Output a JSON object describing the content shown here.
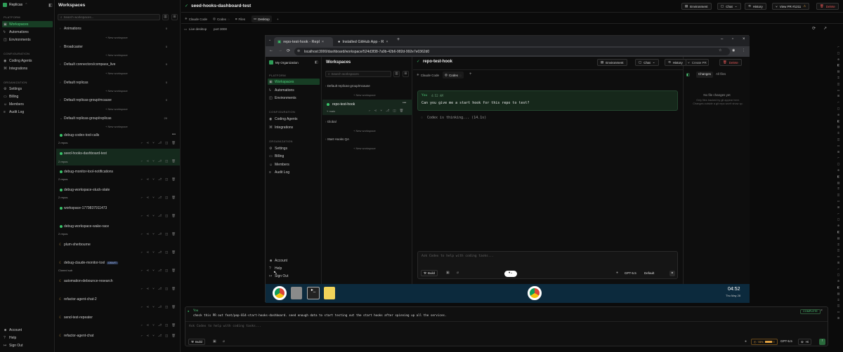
{
  "sidebar": {
    "org": "Replicas",
    "sections": {
      "platform": "PLATFORM",
      "configuration": "CONFIGURATION",
      "organization": "ORGANIZATION"
    },
    "platform_items": [
      "Workspaces",
      "Automations",
      "Environments"
    ],
    "config_items": [
      "Coding Agents",
      "Integrations"
    ],
    "org_items": [
      "Settings",
      "Billing",
      "Members",
      "Audit Log"
    ],
    "bottom_items": [
      "Account",
      "Help",
      "Sign Out"
    ]
  },
  "list": {
    "title": "Workspaces",
    "search_placeholder": "Search workspaces...",
    "groups": [
      {
        "name": "Animations",
        "count": "0"
      },
      {
        "name": "Broadcaster",
        "count": "0"
      },
      {
        "name": "Default connectors/compass_live",
        "count": "0"
      },
      {
        "name": "Default replicas",
        "count": "0"
      },
      {
        "name": "Default replicas-group/mcause",
        "count": "0"
      },
      {
        "name": "Default replicas-group/replicas",
        "count": "20"
      }
    ],
    "new_workspace": "+ New workspace",
    "workspaces": [
      {
        "name": "debug-codex-tool-calls",
        "repos": "2 repos"
      },
      {
        "name": "seed-hooks-dashboard-test",
        "repos": "2 repos"
      },
      {
        "name": "debug-monitor-tool-notifications",
        "repos": "2 repos"
      },
      {
        "name": "debug-workspace-stuck-state",
        "repos": "2 repos"
      },
      {
        "name": "workspace-1779837911473",
        "repos": ""
      },
      {
        "name": "debug-workspace-wake-race",
        "repos": "2 repos"
      },
      {
        "name": "plum-sherbourne",
        "repos": ""
      },
      {
        "name": "debug-claude-monitor-tool",
        "repos": "Cloned sub",
        "badge": "DRAFT"
      },
      {
        "name": "automation-debounce-research",
        "repos": ""
      },
      {
        "name": "refactor-agent-chat-2",
        "repos": ""
      },
      {
        "name": "send-test-repeater",
        "repos": ""
      },
      {
        "name": "refactor-agent-chat",
        "repos": ""
      }
    ]
  },
  "header": {
    "title": "seed-hooks-dashboard-test",
    "environment": "Environment",
    "chat": "Chat",
    "history": "History",
    "view_pr": "View PR #1211",
    "delete": "Delete"
  },
  "tabs": [
    "Claude Code",
    "Codex",
    "Files",
    "Desktop"
  ],
  "desktop_bar": {
    "live": "Live desktop",
    "port": "port 3000"
  },
  "vm": {
    "tab1": "repo-test-hook - Repl",
    "tab2": "Installed GitHub App - R",
    "url": "localhost:3000/dashboard/workspace/524d3f38-7a9b-42b6-982d-992e7e0362d0",
    "app": {
      "org": "My Organization",
      "sections": {
        "platform": "PLATFORM",
        "configuration": "CONFIGURATION",
        "organization": "ORGANIZATION"
      },
      "platform_items": [
        "Workspaces",
        "Automations",
        "Environments"
      ],
      "config_items": [
        "Coding Agents",
        "Integrations"
      ],
      "org_items": [
        "Settings",
        "Billing",
        "Members",
        "Audit Log"
      ],
      "bottom_items": [
        "Account",
        "Help",
        "Sign Out"
      ],
      "list_title": "Workspaces",
      "search_placeholder": "Search workspaces",
      "groups": [
        {
          "name": "Default replicas-group/mcause"
        },
        {
          "name": "repo-test-hook",
          "sub": "main"
        },
        {
          "name": "Global"
        },
        {
          "name": "Start Hooks QA"
        }
      ],
      "new_workspace": "+ New workspace",
      "header_title": "repo-test-hook",
      "environment": "Environment",
      "chat": "Chat",
      "history": "History",
      "create_pr": "Create PR",
      "delete": "Delete",
      "tabs": [
        "Claude Code",
        "Codex"
      ],
      "msg_author": "You",
      "msg_time": "4:52 AM",
      "msg_text": "Can you give me a start hook for this repo to test?",
      "thinking": "Codex is thinking... (14.1s)",
      "input_placeholder": "Ask Codex to help with coding tasks...",
      "build": "Build",
      "model": "GPT-5.5",
      "mode": "Default",
      "changes_tab": "Changes",
      "allfiles_tab": "All files",
      "no_changes": "No file changes yet",
      "no_changes_sub": "Only files tracked by git appear here. Changes outside a git repo won't show up."
    },
    "clock": {
      "time": "04:52",
      "date": "Thu May 28"
    }
  },
  "chat": {
    "author": "You",
    "message": "check this PR out feat/pop-814-start-hooks-dashboard. seed enough data to start testing out the start hooks after spinning up all the services.",
    "status": "COMPLETE",
    "placeholder": "Ask Codex to help with coding tasks...",
    "build": "Build",
    "usage": "78%",
    "model": "GPT-5.5",
    "effort": "Hi"
  }
}
